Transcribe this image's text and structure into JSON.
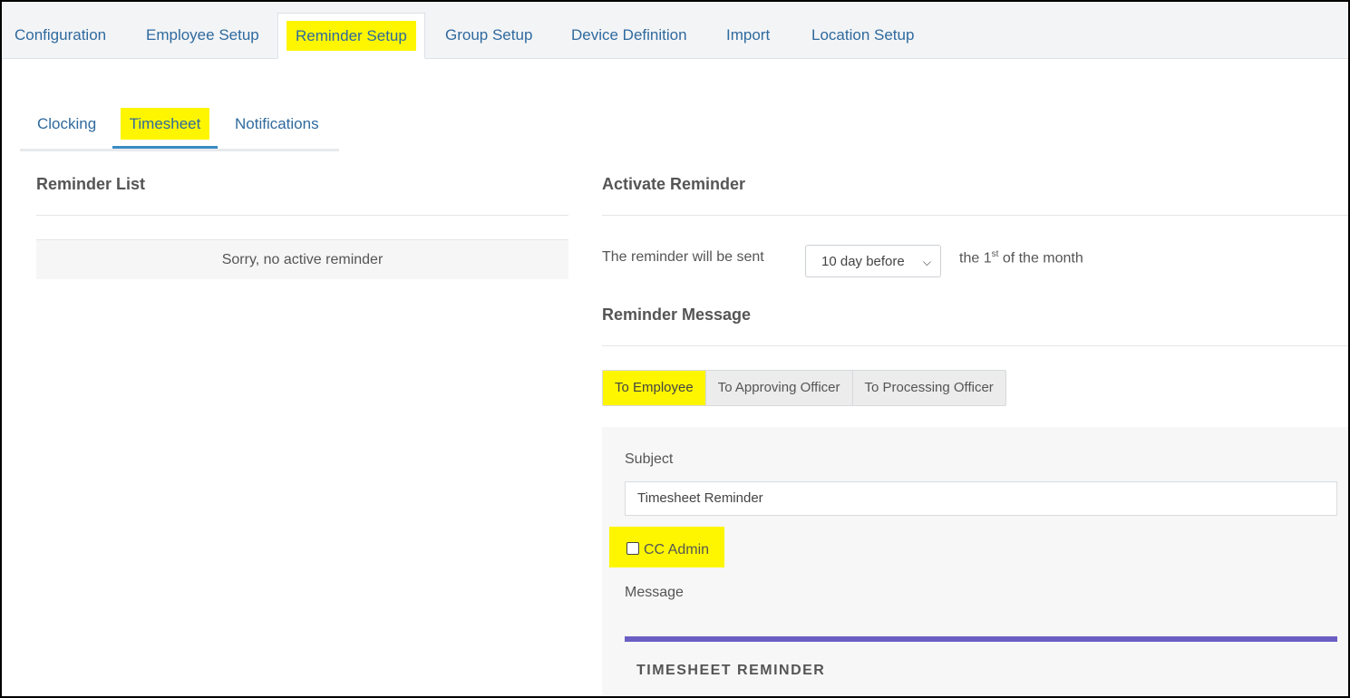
{
  "top_tabs": [
    "Configuration",
    "Employee Setup",
    "Reminder Setup",
    "Group Setup",
    "Device Definition",
    "Import",
    "Location Setup"
  ],
  "sub_tabs": [
    "Clocking",
    "Timesheet",
    "Notifications"
  ],
  "left": {
    "title": "Reminder List",
    "empty_message": "Sorry, no active reminder"
  },
  "right": {
    "title": "Activate Reminder",
    "sent_label": "The reminder will be sent",
    "select_value": "10 day before",
    "after_text_pre": "the 1",
    "after_text_sup": "st",
    "after_text_post": " of the month",
    "message_title": "Reminder Message",
    "recipient_tabs": [
      "To Employee",
      "To Approving Officer",
      "To Processing Officer"
    ],
    "subject_label": "Subject",
    "subject_value": "Timesheet Reminder",
    "cc_label": "CC Admin",
    "message_label": "Message",
    "email_heading": "TIMESHEET REMINDER"
  },
  "colors": {
    "highlight": "#fdf600",
    "link": "#2f6a9e",
    "accent_bar": "#6b5fc4"
  }
}
